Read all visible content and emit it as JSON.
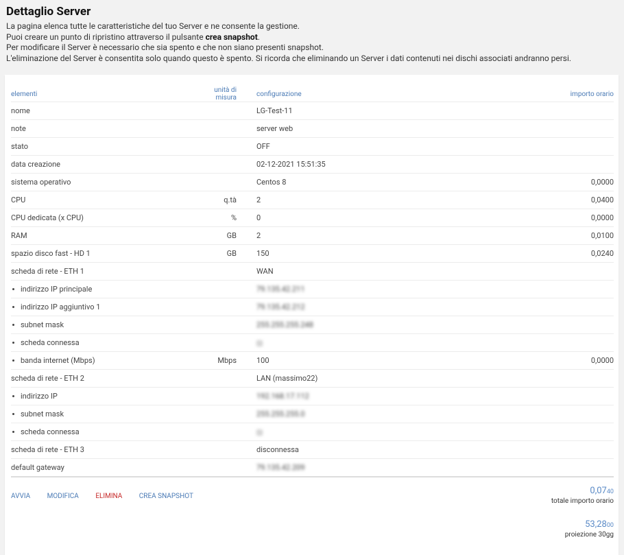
{
  "page": {
    "title": "Dettaglio Server",
    "desc1": "La pagina elenca tutte le caratteristiche del tuo Server e ne consente la gestione.",
    "desc2a": "Puoi creare un punto di ripristino attraverso il pulsante ",
    "desc2b": "crea snapshot",
    "desc2c": ".",
    "desc3": "Per modificare il Server è necessario che sia spento e che non siano presenti snapshot.",
    "desc4": "L'eliminazione del Server è consentita solo quando questo è spento. Si ricorda che eliminando un Server i dati contenuti nei dischi associati andranno persi."
  },
  "table": {
    "headers": {
      "elementi": "elementi",
      "unita": "unità di misura",
      "config": "configurazione",
      "importo": "importo orario"
    },
    "rows": [
      {
        "label": "nome",
        "unit": "",
        "config": "LG-Test-11",
        "amount": ""
      },
      {
        "label": "note",
        "unit": "",
        "config": "server web",
        "amount": ""
      },
      {
        "label": "stato",
        "unit": "",
        "config": "OFF",
        "amount": ""
      },
      {
        "label": "data creazione",
        "unit": "",
        "config": "02-12-2021 15:51:35",
        "amount": ""
      },
      {
        "label": "sistema operativo",
        "unit": "",
        "config": "Centos 8",
        "amount": "0,0000"
      },
      {
        "label": "CPU",
        "unit": "q.tà",
        "config": "2",
        "amount": "0,0400"
      },
      {
        "label": "CPU dedicata (x CPU)",
        "unit": "%",
        "config": "0",
        "amount": "0,0000"
      },
      {
        "label": "RAM",
        "unit": "GB",
        "config": "2",
        "amount": "0,0100"
      },
      {
        "label": "spazio disco fast - HD 1",
        "unit": "GB",
        "config": "150",
        "amount": "0,0240"
      },
      {
        "label": "scheda di rete - ETH 1",
        "unit": "",
        "config": "WAN",
        "amount": ""
      },
      {
        "label": "indirizzo IP principale",
        "unit": "",
        "config": "79.135.42.211",
        "amount": ""
      },
      {
        "label": "indirizzo IP aggiuntivo 1",
        "unit": "",
        "config": "79.135.42.212",
        "amount": ""
      },
      {
        "label": "subnet mask",
        "unit": "",
        "config": "255.255.255.248",
        "amount": ""
      },
      {
        "label": "scheda connessa",
        "unit": "",
        "config": "✓",
        "amount": ""
      },
      {
        "label": "banda internet (Mbps)",
        "unit": "Mbps",
        "config": "100",
        "amount": "0,0000"
      },
      {
        "label": "scheda di rete - ETH 2",
        "unit": "",
        "config": "LAN (massimo22)",
        "amount": ""
      },
      {
        "label": "indirizzo IP",
        "unit": "",
        "config": "192.168.17.112",
        "amount": ""
      },
      {
        "label": "subnet mask",
        "unit": "",
        "config": "255.255.255.0",
        "amount": ""
      },
      {
        "label": "scheda connessa",
        "unit": "",
        "config": "✓",
        "amount": ""
      },
      {
        "label": "scheda di rete - ETH 3",
        "unit": "",
        "config": "disconnessa",
        "amount": ""
      },
      {
        "label": "default gateway",
        "unit": "",
        "config": "79.135.42.209",
        "amount": ""
      }
    ]
  },
  "actions": {
    "avvia": "AVVIA",
    "modifica": "MODIFICA",
    "elimina": "ELIMINA",
    "snapshot": "CREA SNAPSHOT"
  },
  "totals": {
    "orario_main": "0,07",
    "orario_small": "40",
    "orario_label": "totale importo orario",
    "proiezione_main": "53,28",
    "proiezione_small": "00",
    "proiezione_label": "proiezione 30gg"
  },
  "colors": {
    "link": "#4a7ab5",
    "off": "#e53935",
    "delete": "#c62828"
  }
}
